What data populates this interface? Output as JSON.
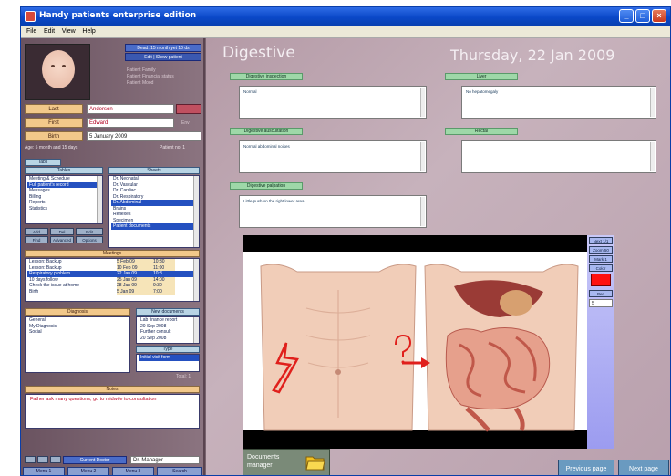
{
  "window": {
    "title": "Handy patients enterprise edition",
    "min": "_",
    "max": "□",
    "close": "×"
  },
  "menu": [
    "File",
    "Edit",
    "View",
    "Help"
  ],
  "patient": {
    "age_line": "Dead: 15 month yet 10 ds",
    "edit_btn": "Edit | Show patient",
    "info": [
      "Patient Family",
      "Patient Financial status",
      "Patient Mood"
    ],
    "last_label": "Last",
    "last_value": "Anderson",
    "first_label": "First",
    "first_value": "Edward",
    "first_extra": "Env",
    "birth_label": "Birth",
    "birth_value": "5  January  2009",
    "age_text": "Age: 5 month and 15 days",
    "patient_no": "Patient no: 1"
  },
  "tables": {
    "left_header": "Tables",
    "left_tab": "Tabs",
    "left_items": [
      "Meeting & Schedule",
      "Full patient's record",
      "Messages",
      "Billing",
      "Reports",
      "Statistics"
    ],
    "left_selected": 1,
    "right_header": "Sheets",
    "right_items": [
      "Dr. Neonatal",
      "Dr. Vascular",
      "Dr. Cardiac",
      "Dr. Respiratory",
      "Dr. Abdominal",
      "Brains",
      "Reflexes",
      "Specimen",
      "Patient documents"
    ],
    "right_selected": [
      4,
      8
    ]
  },
  "grid_buttons": [
    "Add",
    "Del",
    "Edit",
    "Find",
    "Advanced",
    "Options"
  ],
  "meetings": {
    "header": "Meetings",
    "rows": [
      {
        "name": "Lesson: Backup",
        "date": "5 Feb 09",
        "time": "10:30",
        "sel": false
      },
      {
        "name": "Lesson: Backup",
        "date": "10 Feb 09",
        "time": "11:00",
        "sel": false
      },
      {
        "name": "Respiratory problem",
        "date": "22 Jan 09",
        "time": "10:8",
        "sel": true
      },
      {
        "name": "10 days follow",
        "date": "25 Jan 09",
        "time": "14:00",
        "sel": false
      },
      {
        "name": "Check the issue at home",
        "date": "28 Jan 09",
        "time": "9:30",
        "sel": false
      },
      {
        "name": "Birth",
        "date": "5 Jan 09",
        "time": "7:00",
        "sel": false
      }
    ]
  },
  "diagnosis": {
    "header": "Diagnosis",
    "items": [
      "General",
      "My Diagnosis",
      "Social"
    ]
  },
  "documents": {
    "header": "New documents",
    "items": [
      "Lab finance report",
      "20 Sep 2008",
      "Further consult",
      "20 Sep 2008"
    ],
    "header2": "Type",
    "items2": [
      "Initial visit form"
    ],
    "count": "Total: 1"
  },
  "notes": {
    "header": "Notes",
    "text": "Father ask many questions, go to midwife to consultation"
  },
  "bottom": {
    "status_label": "Current Doctor",
    "status_value": "Dr. Manager",
    "buttons": [
      "Menu 1",
      "Menu 2",
      "Menu 3",
      "Search"
    ]
  },
  "main": {
    "section": "Digestive",
    "date": "Thursday, 22 Jan 2009",
    "fields": [
      {
        "label": "Digestive inspection",
        "value": "Normal"
      },
      {
        "label": "Liver",
        "value": "No hepatomegaly"
      },
      {
        "label": "Digestive auscultation",
        "value": "Normal abdominal noises"
      },
      {
        "label": "Rectal",
        "value": ""
      },
      {
        "label": "Digestive palpation",
        "value": "Little push on the right lower area"
      }
    ],
    "side_controls": [
      "Next 1/1",
      "Zoom 50",
      "Mark 1",
      "Color",
      "Pen",
      "5"
    ],
    "docs_manager": "Documents manager",
    "prev": "Previous page",
    "next": "Next page"
  },
  "colors": {
    "accent": "#2450c0",
    "panel": "#c7b2bc",
    "label": "#f2c88a"
  }
}
